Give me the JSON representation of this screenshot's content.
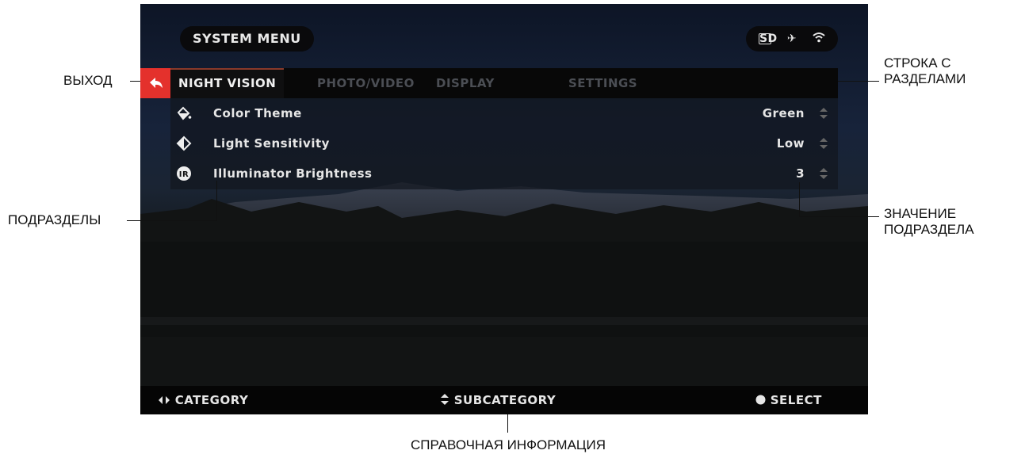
{
  "header": {
    "title": "SYSTEM MENU",
    "status_icons": [
      "sd-card-icon",
      "satellite-icon",
      "wifi-icon"
    ]
  },
  "tabs": [
    "NIGHT VISION",
    "PHOTO/VIDEO",
    "DISPLAY",
    "SETTINGS"
  ],
  "active_tab": "NIGHT VISION",
  "rows": [
    {
      "label": "Color Theme",
      "value": "Green",
      "icon": "paint-bucket-icon"
    },
    {
      "label": "Light Sensitivity",
      "value": "Low",
      "icon": "contrast-icon"
    },
    {
      "label": "Illuminator Brightness",
      "value": "3",
      "icon": "ir-icon"
    }
  ],
  "footer": {
    "left": "CATEGORY",
    "center": "SUBCATEGORY",
    "right": "SELECT"
  },
  "callouts": {
    "exit": "ВЫХОД",
    "tabs_line1": "СТРОКА С",
    "tabs_line2": "РАЗДЕЛАМИ",
    "subsections": "ПОДРАЗДЕЛЫ",
    "value_line1": "ЗНАЧЕНИЕ",
    "value_line2": "ПОДРАЗДЕЛА",
    "help": "СПРАВОЧНАЯ ИНФОРМАЦИЯ"
  },
  "colors": {
    "accent": "#e4312c",
    "active_text": "#f0f0f0",
    "inactive_tab": "#4b4e54"
  }
}
